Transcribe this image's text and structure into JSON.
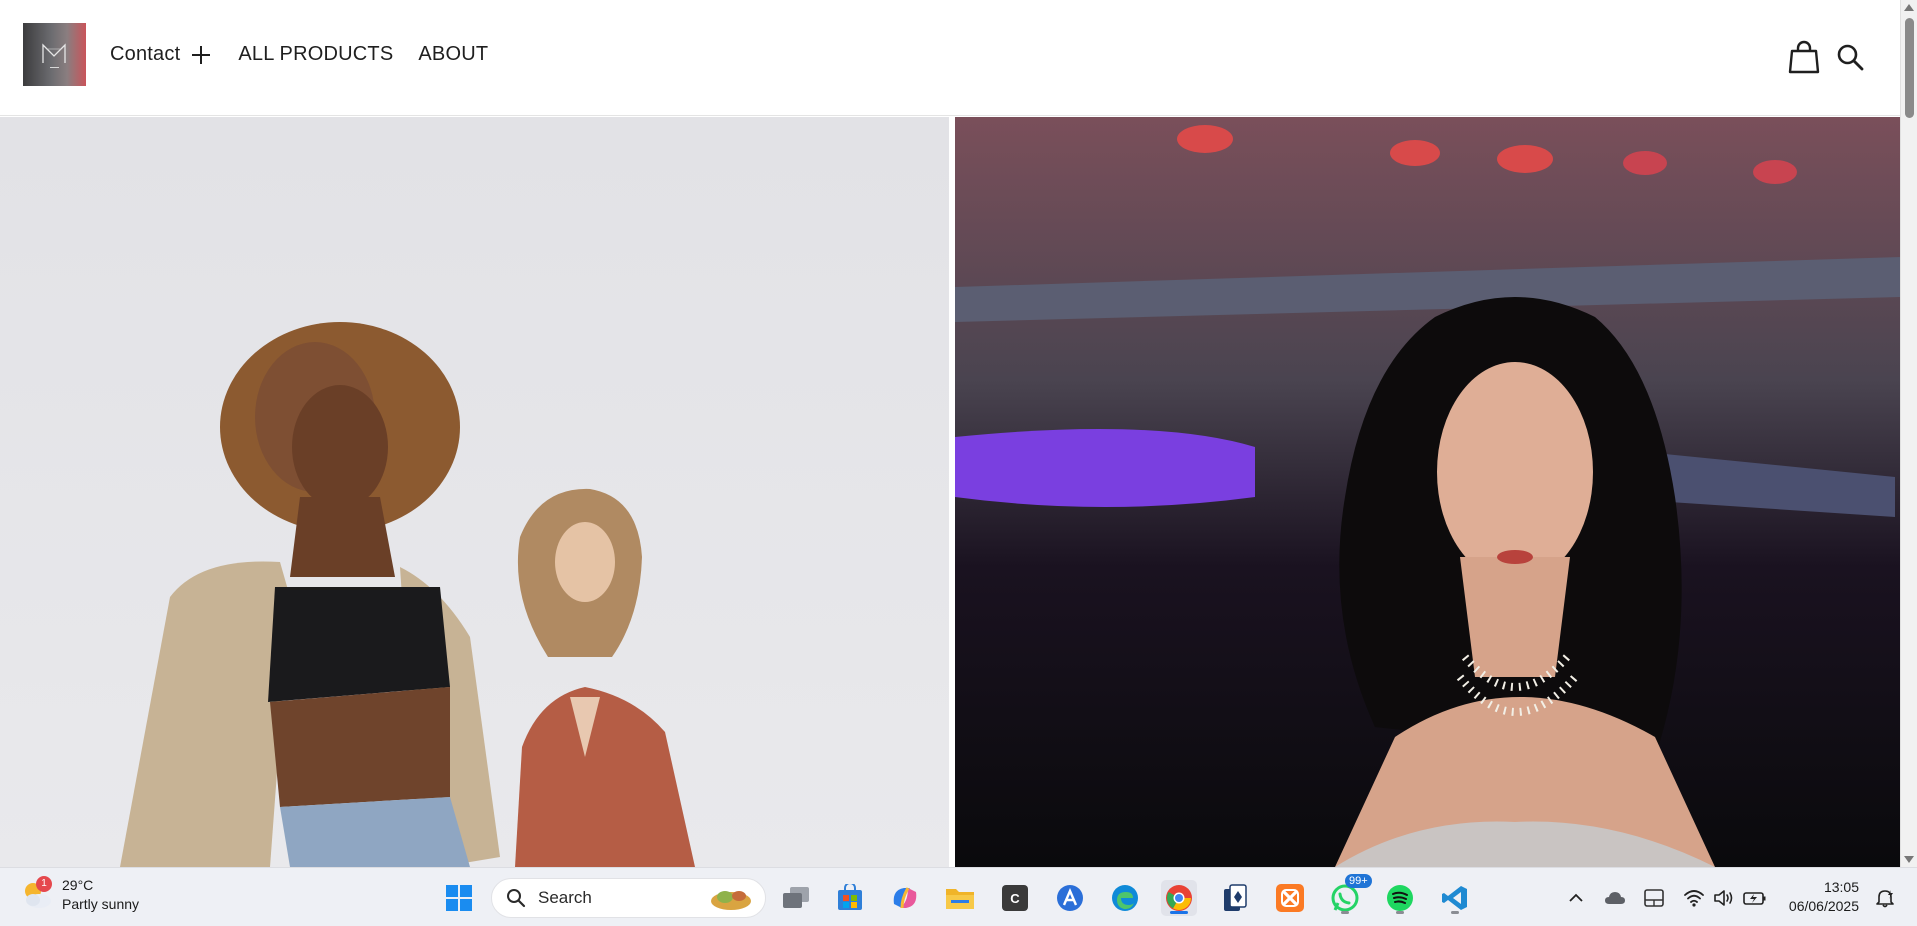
{
  "header": {
    "nav": {
      "contact_label": "Contact",
      "all_products_label": "ALL PRODUCTS",
      "about_label": "ABOUT"
    },
    "icons": [
      "shopping-bag-icon",
      "search-icon"
    ]
  },
  "hero": {
    "images": [
      "fashion-models-photo",
      "model-pearl-necklace-photo"
    ]
  },
  "taskbar": {
    "weather": {
      "temp": "29°C",
      "condition": "Partly sunny",
      "badge": "1"
    },
    "search": {
      "label": "Search"
    },
    "pinned": [
      "windows-start",
      "task-view",
      "microsoft-store",
      "copilot",
      "file-explorer",
      "c-app",
      "a-app",
      "edge",
      "chrome",
      "solitaire",
      "xampp",
      "whatsapp",
      "spotify",
      "vscode"
    ],
    "whatsapp_badge": "99+",
    "clock": {
      "time": "13:05",
      "date": "06/06/2025"
    }
  },
  "colors": {
    "accent": "#1a73e8",
    "logo_red": "#c9545a",
    "taskbar_bg": "#eef0f5"
  }
}
